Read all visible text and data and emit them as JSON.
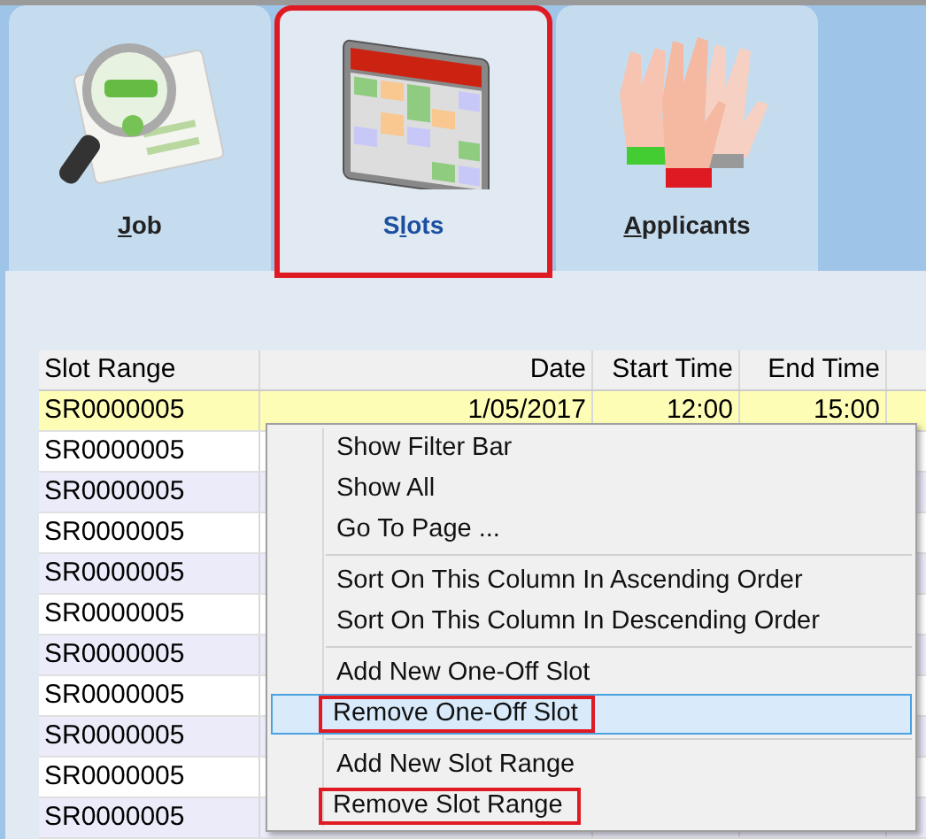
{
  "tabs": [
    {
      "label_parts": [
        {
          "text": "J",
          "underlined": true
        },
        {
          "text": "ob",
          "underlined": false
        }
      ],
      "selected": false,
      "marked": false
    },
    {
      "label_parts": [
        {
          "text": "S",
          "underlined": false
        },
        {
          "text": "l",
          "underlined": true
        },
        {
          "text": "ots",
          "underlined": false
        }
      ],
      "selected": true,
      "marked": true
    },
    {
      "label_parts": [
        {
          "text": "A",
          "underlined": true
        },
        {
          "text": "pplicants",
          "underlined": false
        }
      ],
      "selected": false,
      "marked": false
    }
  ],
  "table": {
    "columns": [
      "Slot Range",
      "Date",
      "Start Time",
      "End Time"
    ],
    "rows": [
      {
        "cells": [
          "SR0000005",
          "1/05/2017",
          "12:00",
          "15:00"
        ],
        "selected": true
      },
      {
        "cells": [
          "SR0000005"
        ],
        "selected": false
      },
      {
        "cells": [
          "SR0000005"
        ],
        "selected": false
      },
      {
        "cells": [
          "SR0000005"
        ],
        "selected": false
      },
      {
        "cells": [
          "SR0000005"
        ],
        "selected": false
      },
      {
        "cells": [
          "SR0000005"
        ],
        "selected": false
      },
      {
        "cells": [
          "SR0000005"
        ],
        "selected": false
      },
      {
        "cells": [
          "SR0000005"
        ],
        "selected": false
      },
      {
        "cells": [
          "SR0000005"
        ],
        "selected": false
      },
      {
        "cells": [
          "SR0000005"
        ],
        "selected": false
      },
      {
        "cells": [
          "SR0000005"
        ],
        "selected": false
      }
    ]
  },
  "context_menu": {
    "groups": [
      [
        {
          "label": "Show Filter Bar",
          "highlighted": false,
          "marked": false
        },
        {
          "label": "Show All",
          "highlighted": false,
          "marked": false
        },
        {
          "label": "Go To Page ...",
          "highlighted": false,
          "marked": false
        }
      ],
      [
        {
          "label": "Sort On This Column In Ascending Order",
          "highlighted": false,
          "marked": false
        },
        {
          "label": "Sort On This Column In Descending Order",
          "highlighted": false,
          "marked": false
        }
      ],
      [
        {
          "label": "Add New One-Off Slot",
          "highlighted": false,
          "marked": false
        },
        {
          "label": "Remove One-Off Slot",
          "highlighted": true,
          "marked": true
        }
      ],
      [
        {
          "label": "Add New Slot Range",
          "highlighted": false,
          "marked": false
        },
        {
          "label": "Remove Slot Range",
          "highlighted": false,
          "marked": true
        }
      ]
    ]
  }
}
